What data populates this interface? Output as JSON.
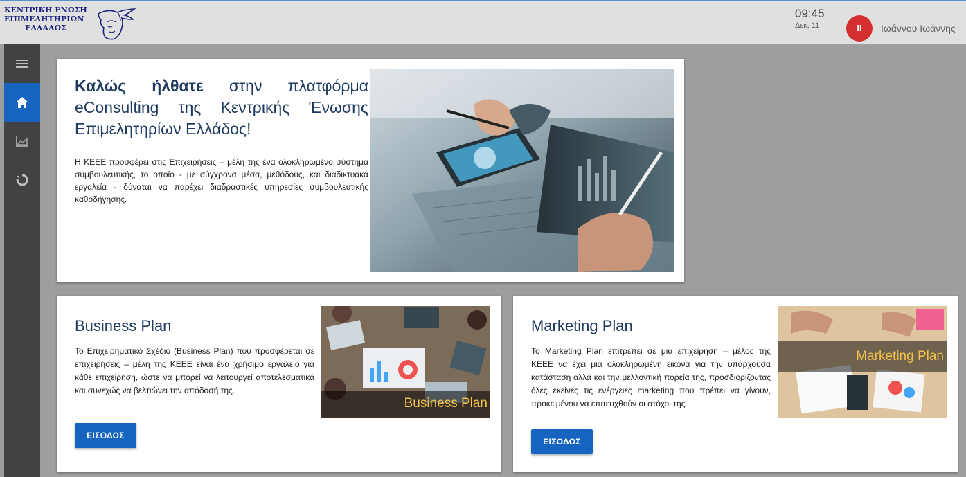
{
  "header": {
    "logo_lines": [
      "ΚΕΝΤΡΙΚΗ ΕΝΩΣΗ",
      "ΕΠΙΜΕΛΗΤΗΡΙΩΝ",
      "ΕΛΛΑΔΟΣ"
    ],
    "time": "09:45",
    "date": "Δεκ, 11",
    "avatar_initials": "ΙΙ",
    "user_name": "Ιωάννου Ιωάννης"
  },
  "sidebar": {
    "items": [
      {
        "icon": "menu-icon",
        "active": false
      },
      {
        "icon": "home-icon",
        "active": true
      },
      {
        "icon": "chart-icon",
        "active": false
      },
      {
        "icon": "refresh-icon",
        "active": false
      }
    ]
  },
  "welcome": {
    "title_bold": "Καλώς ήλθατε",
    "title_rest": " στην πλατφόρμα eConsulting της Κεντρικής Ένωσης Επιμελητηρίων Ελλάδος!",
    "body": "Η ΚΕΕΕ προσφέρει στις Επιχειρήσεις – μέλη της ένα ολοκληρωμένο σύστημα συμβουλευτικής, το οποίο - με σύγχρονα μέσα, μεθόδους, και διαδικτυακά εργαλεία - δύναται να παρέχει διαδραστικές υπηρεσίες συμβουλευτικής καθοδήγησης."
  },
  "business_plan": {
    "title": "Business Plan",
    "body": "Το Επιχειρηματικό Σχέδιο (Business Plan) που προσφέρεται σε επιχειρήσεις – μέλη της ΚΕΕΕ είναι ένα χρήσιμο εργαλείο για κάθε επιχείρηση, ώστε να μπορεί να λειτουργεί αποτελεσματικά και συνεχώς να βελτιώνει την απόδοσή της.",
    "button_label": "ΕΙΣΟΔΟΣ",
    "image_label": "Business Plan"
  },
  "marketing_plan": {
    "title": "Marketing Plan",
    "body": "Το Marketing Plan επιτρέπει σε μια επιχείρηση – μέλος της ΚΕΕΕ να έχει μια ολοκληρωμένη εικόνα για την υπάρχουσα κατάσταση αλλά και την μελλοντική πορεία της, προσδιορίζοντας όλες εκείνες τις ενέργειες marketing που πρέπει να γίνουν, προκειμένου να επιτευχθούν οι στόχοι της.",
    "button_label": "ΕΙΣΟΔΟΣ",
    "image_label": "Marketing Plan"
  },
  "colors": {
    "accent": "#1565c0",
    "avatar": "#d32f2f",
    "sidebar": "#424242",
    "background": "#9e9e9e",
    "image_label": "#f3c04a"
  }
}
